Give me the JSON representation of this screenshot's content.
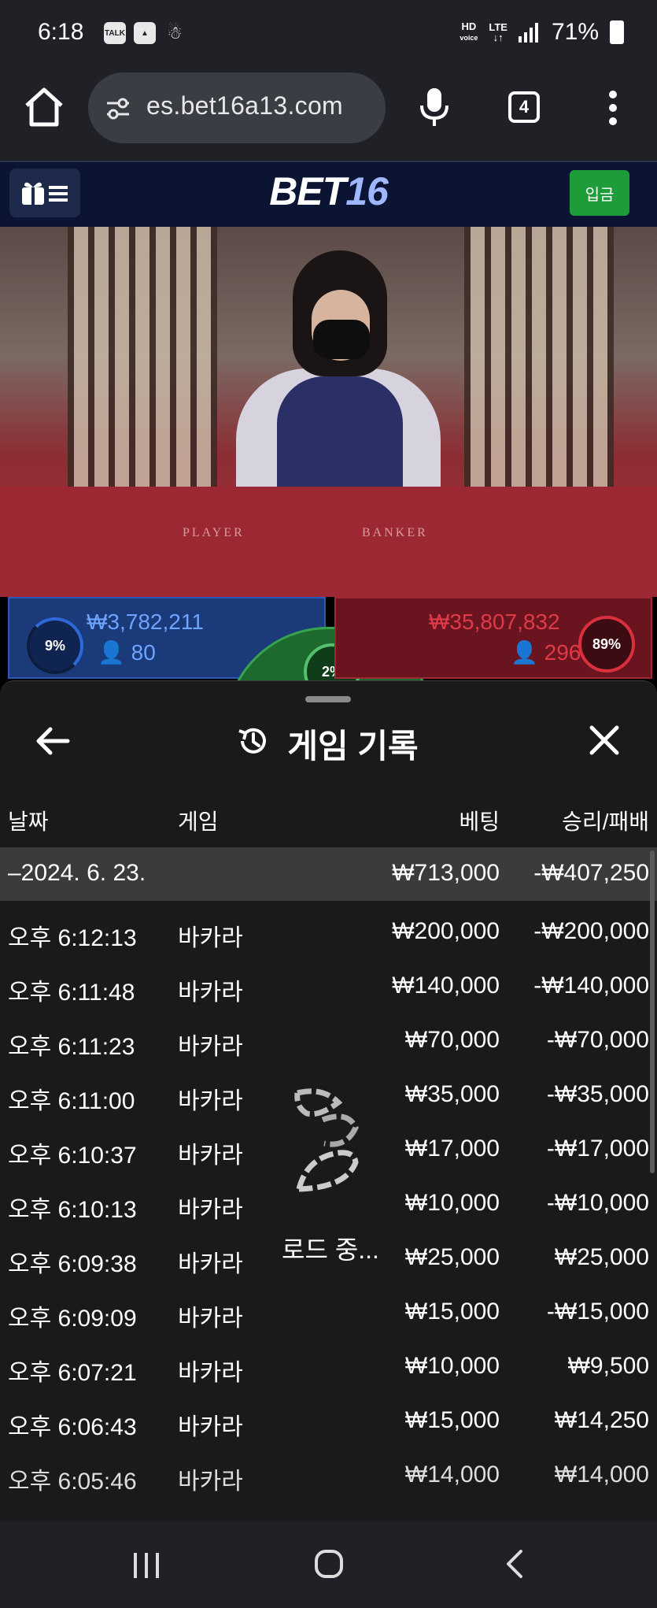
{
  "status_bar": {
    "time": "6:18",
    "notification_icons": [
      "talk-icon",
      "image-icon",
      "child-icon"
    ],
    "net_hd": "HD",
    "net_voice": "voice",
    "net_lte": "LTE",
    "battery": "71%"
  },
  "browser": {
    "url": "es.bet16a13.com",
    "tab_count": "4"
  },
  "site": {
    "logo_text": "BET",
    "logo_number": "16",
    "deposit_label": "입금"
  },
  "video": {
    "player_label": "PLAYER",
    "banker_label": "BANKER"
  },
  "bets_summary": {
    "player": {
      "percent": "9%",
      "amount": "₩3,782,211",
      "users": "80"
    },
    "tie": {
      "percent": "2%"
    },
    "banker": {
      "percent": "89%",
      "amount": "₩35,807,832",
      "users": "296"
    }
  },
  "history_modal": {
    "title": "게임 기록",
    "columns": {
      "date": "날짜",
      "game": "게임",
      "bet": "베팅",
      "win_loss": "승리/패배"
    },
    "summary_row": {
      "date": "–2024. 6. 23.",
      "bet": "₩713,000",
      "win_loss": "-₩407,250"
    },
    "rows": [
      {
        "time": "오후 6:12:13",
        "game": "바카라",
        "bet": "₩200,000",
        "win_loss": "-₩200,000"
      },
      {
        "time": "오후 6:11:48",
        "game": "바카라",
        "bet": "₩140,000",
        "win_loss": "-₩140,000"
      },
      {
        "time": "오후 6:11:23",
        "game": "바카라",
        "bet": "₩70,000",
        "win_loss": "-₩70,000"
      },
      {
        "time": "오후 6:11:00",
        "game": "바카라",
        "bet": "₩35,000",
        "win_loss": "-₩35,000"
      },
      {
        "time": "오후 6:10:37",
        "game": "바카라",
        "bet": "₩17,000",
        "win_loss": "-₩17,000"
      },
      {
        "time": "오후 6:10:13",
        "game": "바카라",
        "bet": "₩10,000",
        "win_loss": "-₩10,000"
      },
      {
        "time": "오후 6:09:38",
        "game": "바카라",
        "bet": "₩25,000",
        "win_loss": "₩25,000"
      },
      {
        "time": "오후 6:09:09",
        "game": "바카라",
        "bet": "₩15,000",
        "win_loss": "-₩15,000"
      },
      {
        "time": "오후 6:07:21",
        "game": "바카라",
        "bet": "₩10,000",
        "win_loss": "₩9,500"
      },
      {
        "time": "오후 6:06:43",
        "game": "바카라",
        "bet": "₩15,000",
        "win_loss": "₩14,250"
      },
      {
        "time": "오후 6:05:46",
        "game": "바카라",
        "bet": "₩14,000",
        "win_loss": "₩14,000"
      }
    ],
    "loading_text": "로드 중..."
  }
}
